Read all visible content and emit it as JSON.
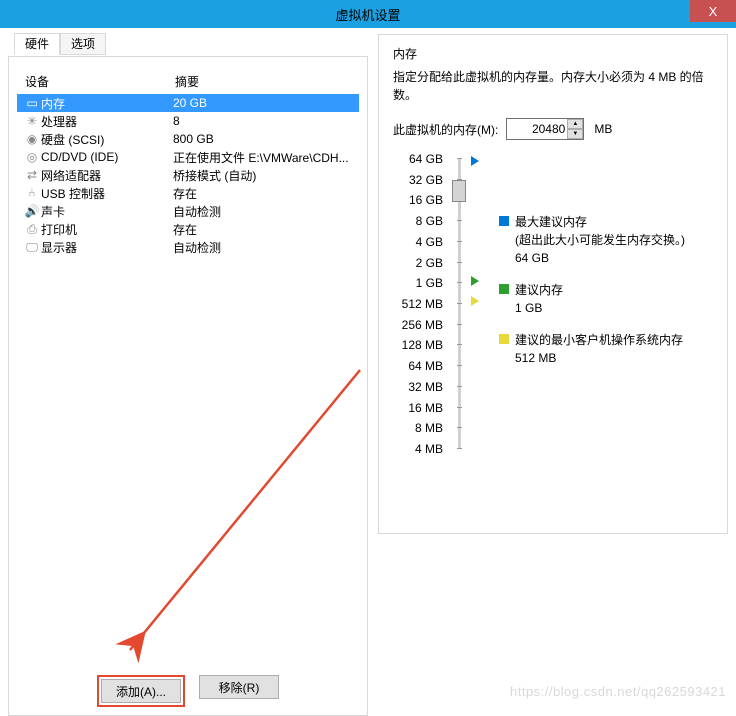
{
  "window": {
    "title": "虚拟机设置",
    "close": "X"
  },
  "tabs": {
    "hardware": "硬件",
    "options": "选项"
  },
  "hw_header": {
    "device": "设备",
    "summary": "摘要"
  },
  "devices": [
    {
      "icon": "memory",
      "name": "内存",
      "summary": "20 GB",
      "selected": true
    },
    {
      "icon": "cpu",
      "name": "处理器",
      "summary": "8"
    },
    {
      "icon": "disk",
      "name": "硬盘 (SCSI)",
      "summary": "800 GB"
    },
    {
      "icon": "cd",
      "name": "CD/DVD (IDE)",
      "summary": "正在使用文件 E:\\VMWare\\CDH..."
    },
    {
      "icon": "net",
      "name": "网络适配器",
      "summary": "桥接模式 (自动)"
    },
    {
      "icon": "usb",
      "name": "USB 控制器",
      "summary": "存在"
    },
    {
      "icon": "sound",
      "name": "声卡",
      "summary": "自动检测"
    },
    {
      "icon": "printer",
      "name": "打印机",
      "summary": "存在"
    },
    {
      "icon": "display",
      "name": "显示器",
      "summary": "自动检测"
    }
  ],
  "buttons": {
    "add": "添加(A)...",
    "remove": "移除(R)"
  },
  "memory": {
    "title": "内存",
    "desc": "指定分配给此虚拟机的内存量。内存大小必须为 4 MB 的倍数。",
    "label": "此虚拟机的内存(M):",
    "value": "20480",
    "unit": "MB",
    "ticks": [
      "64 GB",
      "32 GB",
      "16 GB",
      "8 GB",
      "4 GB",
      "2 GB",
      "1 GB",
      "512 MB",
      "256 MB",
      "128 MB",
      "64 MB",
      "32 MB",
      "16 MB",
      "8 MB",
      "4 MB"
    ],
    "legend": {
      "max": {
        "label": "最大建议内存",
        "note": "(超出此大小可能发生内存交换。)",
        "value": "64 GB"
      },
      "rec": {
        "label": "建议内存",
        "value": "1 GB"
      },
      "min": {
        "label": "建议的最小客户机操作系统内存",
        "value": "512 MB"
      }
    }
  },
  "watermark": "https://blog.csdn.net/qq262593421"
}
